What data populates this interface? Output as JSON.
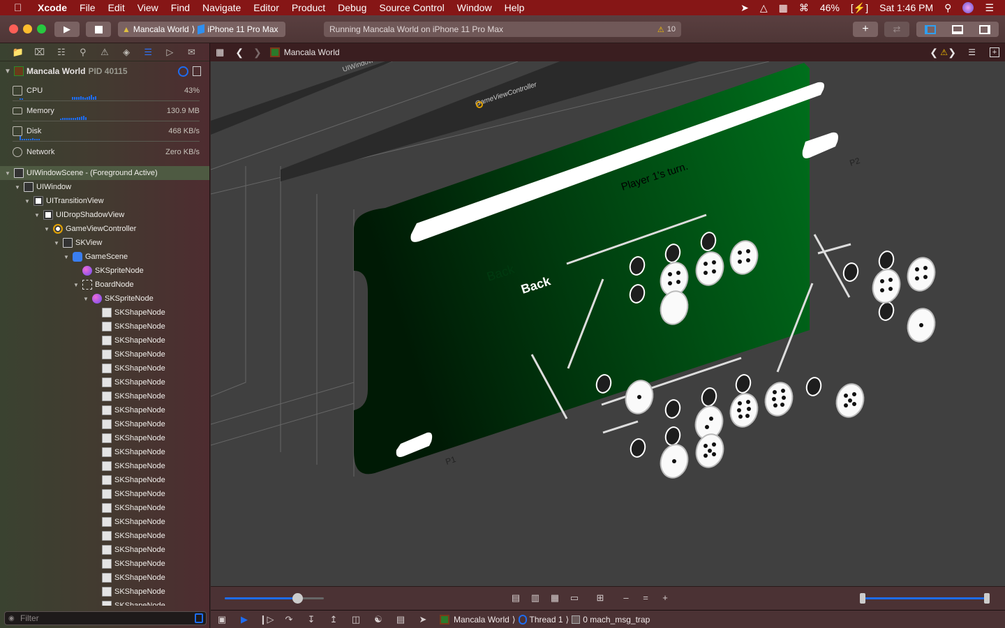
{
  "menubar": {
    "apple": "",
    "app": "Xcode",
    "items": [
      "File",
      "Edit",
      "View",
      "Find",
      "Navigate",
      "Editor",
      "Product",
      "Debug",
      "Source Control",
      "Window",
      "Help"
    ],
    "battery": "46%",
    "clock": "Sat 1:46 PM"
  },
  "toolbar": {
    "scheme_project": "Mancala World",
    "scheme_device": "iPhone 11 Pro Max",
    "activity": "Running Mancala World on iPhone 11 Pro Max",
    "warning_count": "10"
  },
  "navigator": {
    "process": {
      "name": "Mancala World",
      "pid": "PID 40115"
    },
    "gauges": [
      {
        "label": "CPU",
        "value": "43%"
      },
      {
        "label": "Memory",
        "value": "130.9 MB"
      },
      {
        "label": "Disk",
        "value": "468 KB/s"
      },
      {
        "label": "Network",
        "value": "Zero KB/s"
      }
    ],
    "tree": [
      {
        "label": "UIWindowScene - (Foreground Active)",
        "depth": 0,
        "icon": "scene-box",
        "expanded": true,
        "selected": true
      },
      {
        "label": "UIWindow",
        "depth": 1,
        "icon": "box",
        "expanded": true
      },
      {
        "label": "UITransitionView",
        "depth": 2,
        "icon": "white",
        "expanded": true
      },
      {
        "label": "UIDropShadowView",
        "depth": 3,
        "icon": "white",
        "expanded": true
      },
      {
        "label": "GameViewController",
        "depth": 4,
        "icon": "vc",
        "expanded": true
      },
      {
        "label": "SKView",
        "depth": 5,
        "icon": "box",
        "expanded": true
      },
      {
        "label": "GameScene",
        "depth": 6,
        "icon": "scene",
        "expanded": true
      },
      {
        "label": "SKSpriteNode",
        "depth": 7,
        "icon": "sprite"
      },
      {
        "label": "BoardNode",
        "depth": 7,
        "icon": "board",
        "expanded": true
      },
      {
        "label": "SKSpriteNode",
        "depth": 8,
        "icon": "sprite",
        "expanded": true
      },
      {
        "label": "SKShapeNode",
        "depth": 9,
        "icon": "shape"
      },
      {
        "label": "SKShapeNode",
        "depth": 9,
        "icon": "shape"
      },
      {
        "label": "SKShapeNode",
        "depth": 9,
        "icon": "shape"
      },
      {
        "label": "SKShapeNode",
        "depth": 9,
        "icon": "shape"
      },
      {
        "label": "SKShapeNode",
        "depth": 9,
        "icon": "shape"
      },
      {
        "label": "SKShapeNode",
        "depth": 9,
        "icon": "shape"
      },
      {
        "label": "SKShapeNode",
        "depth": 9,
        "icon": "shape"
      },
      {
        "label": "SKShapeNode",
        "depth": 9,
        "icon": "shape"
      },
      {
        "label": "SKShapeNode",
        "depth": 9,
        "icon": "shape"
      },
      {
        "label": "SKShapeNode",
        "depth": 9,
        "icon": "shape"
      },
      {
        "label": "SKShapeNode",
        "depth": 9,
        "icon": "shape"
      },
      {
        "label": "SKShapeNode",
        "depth": 9,
        "icon": "shape"
      },
      {
        "label": "SKShapeNode",
        "depth": 9,
        "icon": "shape"
      },
      {
        "label": "SKShapeNode",
        "depth": 9,
        "icon": "shape"
      },
      {
        "label": "SKShapeNode",
        "depth": 9,
        "icon": "shape"
      },
      {
        "label": "SKShapeNode",
        "depth": 9,
        "icon": "shape"
      },
      {
        "label": "SKShapeNode",
        "depth": 9,
        "icon": "shape"
      },
      {
        "label": "SKShapeNode",
        "depth": 9,
        "icon": "shape"
      },
      {
        "label": "SKShapeNode",
        "depth": 9,
        "icon": "shape"
      },
      {
        "label": "SKShapeNode",
        "depth": 9,
        "icon": "shape"
      },
      {
        "label": "SKShapeNode",
        "depth": 9,
        "icon": "shape"
      },
      {
        "label": "SKShapeNode",
        "depth": 9,
        "icon": "shape"
      }
    ],
    "filter_placeholder": "Filter"
  },
  "editor": {
    "breadcrumb": "Mancala World",
    "view_labels": {
      "window": "UIWindow",
      "controller": "GameViewController"
    },
    "game": {
      "turn_text": "Player 1's turn.",
      "back_label": "Back",
      "p1": "P1",
      "p2": "P2"
    }
  },
  "statusbar": {
    "process": "Mancala World",
    "thread": "Thread 1",
    "frame": "0 mach_msg_trap"
  },
  "colors": {
    "accent": "#1e6cf0",
    "menubar": "#861616",
    "board_green": "#006b1a"
  }
}
